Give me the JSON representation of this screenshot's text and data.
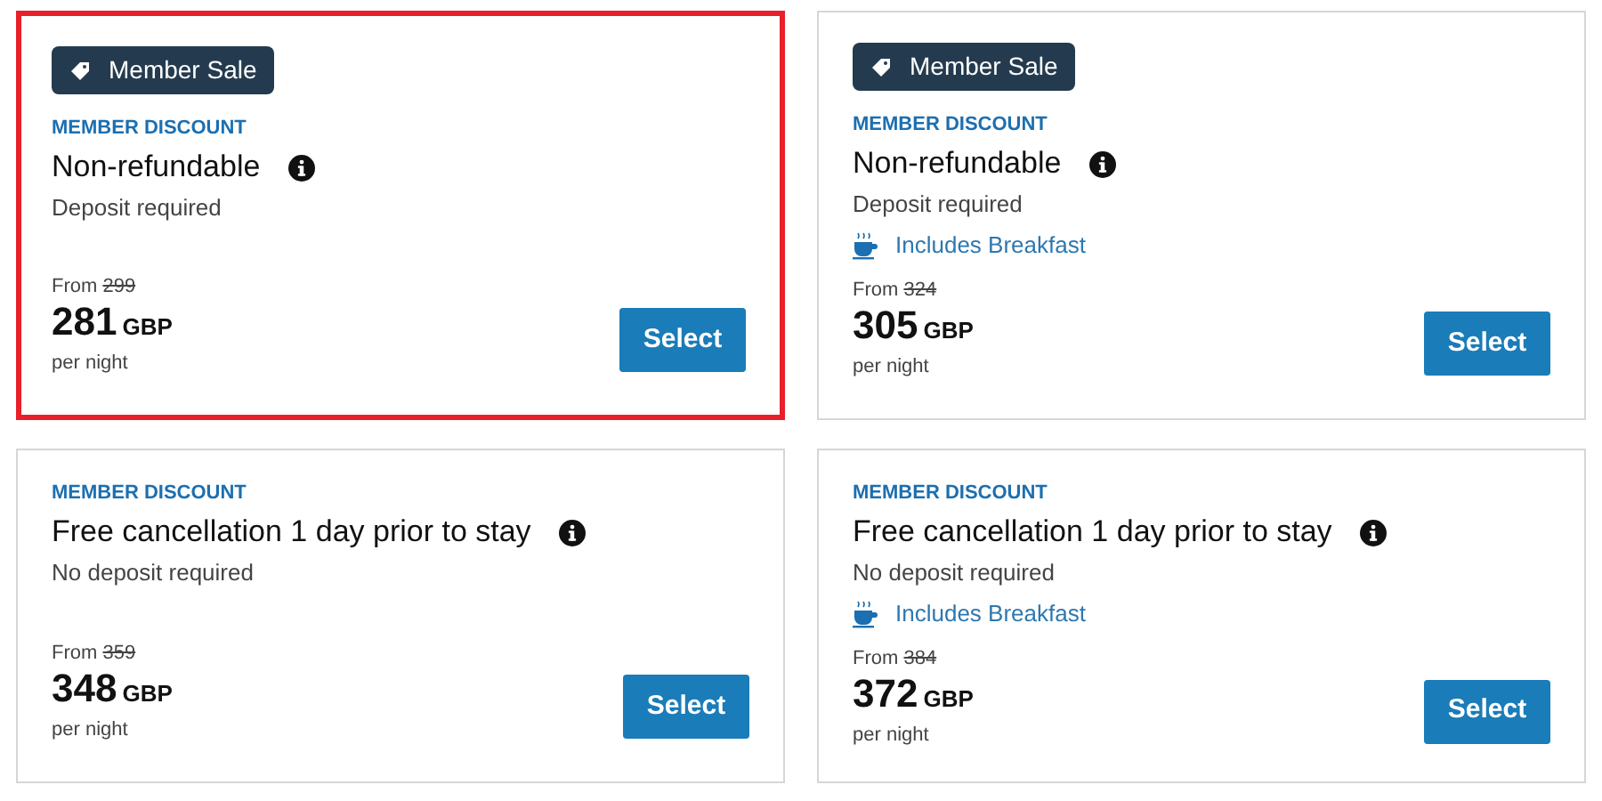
{
  "rates": [
    {
      "selected": true,
      "badge": "Member Sale",
      "label": "MEMBER DISCOUNT",
      "title": "Non-refundable",
      "subtitle": "Deposit required",
      "from": "From",
      "old_price": "299",
      "price": "281",
      "currency": "GBP",
      "unit": "per night",
      "button": "Select"
    },
    {
      "selected": false,
      "badge": "Member Sale",
      "label": "MEMBER DISCOUNT",
      "title": "Non-refundable",
      "subtitle": "Deposit required",
      "perk": "Includes Breakfast",
      "from": "From",
      "old_price": "324",
      "price": "305",
      "currency": "GBP",
      "unit": "per night",
      "button": "Select"
    },
    {
      "selected": false,
      "label": "MEMBER DISCOUNT",
      "title": "Free cancellation 1 day prior to stay",
      "subtitle": "No deposit required",
      "from": "From",
      "old_price": "359",
      "price": "348",
      "currency": "GBP",
      "unit": "per night",
      "button": "Select"
    },
    {
      "selected": false,
      "label": "MEMBER DISCOUNT",
      "title": "Free cancellation 1 day prior to stay",
      "subtitle": "No deposit required",
      "perk": "Includes Breakfast",
      "from": "From",
      "old_price": "384",
      "price": "372",
      "currency": "GBP",
      "unit": "per night",
      "button": "Select"
    }
  ]
}
